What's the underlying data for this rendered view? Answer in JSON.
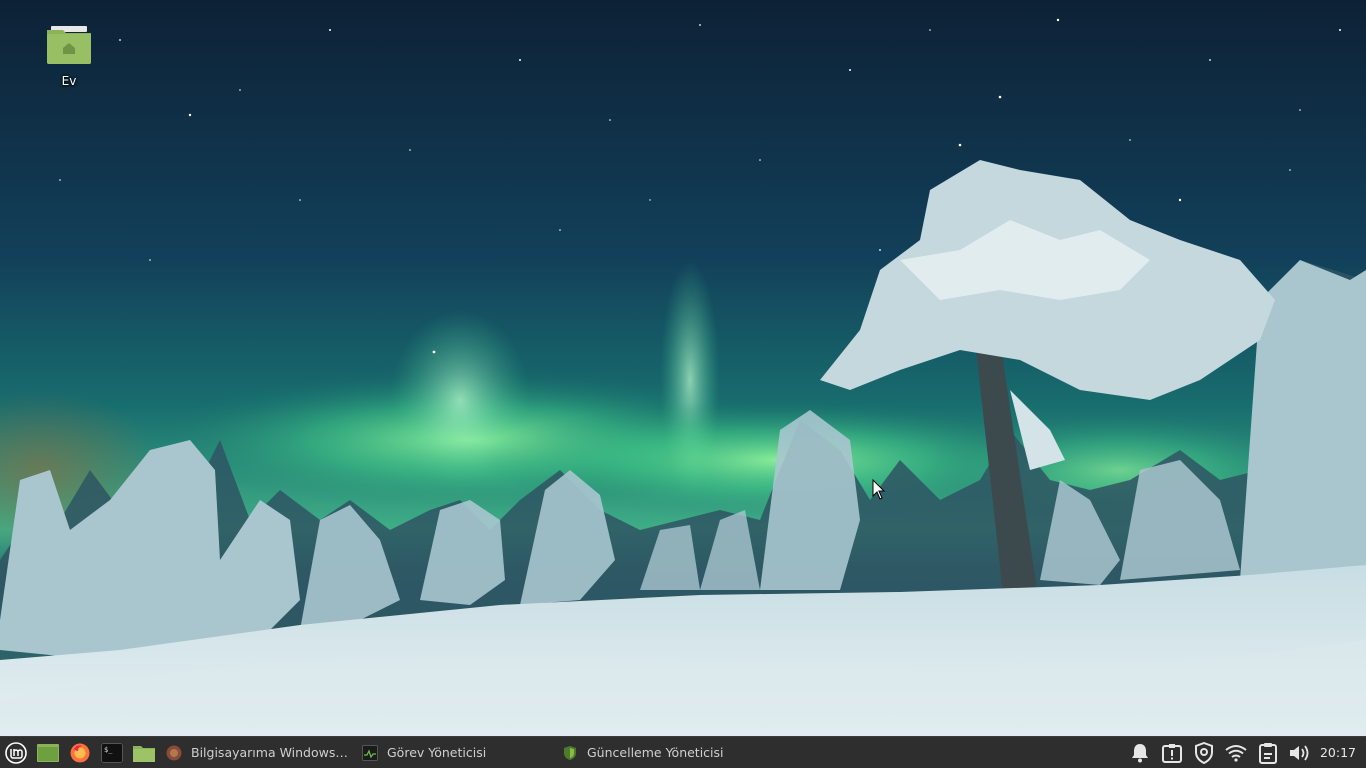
{
  "desktop": {
    "icons": [
      {
        "label": "Ev",
        "icon": "home-folder-icon"
      }
    ]
  },
  "panel": {
    "launchers": [
      {
        "name": "menu",
        "icon": "linux-mint-menu-icon"
      },
      {
        "name": "show-desktop",
        "icon": "show-desktop-icon"
      },
      {
        "name": "firefox",
        "icon": "firefox-icon"
      },
      {
        "name": "terminal",
        "icon": "terminal-icon"
      },
      {
        "name": "files",
        "icon": "files-folder-icon"
      }
    ],
    "tasks": [
      {
        "label": "Bilgisayarıma Windows XP...",
        "icon": "firefox-icon"
      },
      {
        "label": "Görev Yöneticisi",
        "icon": "system-monitor-icon"
      },
      {
        "label": "Güncelleme Yöneticisi",
        "icon": "update-manager-shield-icon"
      }
    ],
    "tray": [
      {
        "name": "notifications",
        "icon": "bell-icon"
      },
      {
        "name": "updates",
        "icon": "update-alert-icon"
      },
      {
        "name": "shield",
        "icon": "shield-icon"
      },
      {
        "name": "network",
        "icon": "wifi-icon"
      },
      {
        "name": "clipboard",
        "icon": "clipboard-icon"
      },
      {
        "name": "volume",
        "icon": "volume-icon"
      }
    ],
    "clock": "20:17"
  },
  "colors": {
    "panel_bg": "#2e2e2e",
    "folder_green": "#8cb35a",
    "mint_accent": "#86be43"
  }
}
